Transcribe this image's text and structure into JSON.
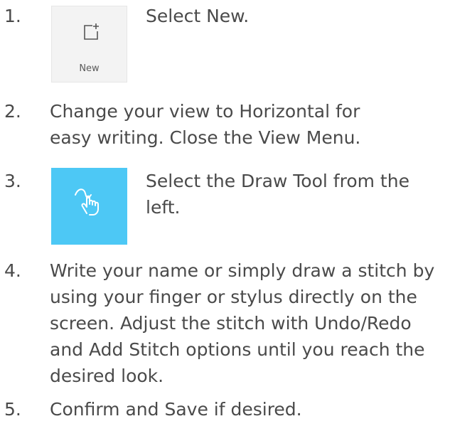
{
  "steps": [
    {
      "number": "1.",
      "text": "Select New.",
      "thumbnail": {
        "kind": "new-button",
        "icon": "new-document-icon",
        "label": "New"
      }
    },
    {
      "number": "2.",
      "text": "Change your view to Horizontal for easy writing. Close the View Menu."
    },
    {
      "number": "3.",
      "text": "Select the Draw Tool from the left.",
      "thumbnail": {
        "kind": "draw-tool",
        "icon": "draw-hand-icon",
        "color": "#4dc8f5"
      }
    },
    {
      "number": "4.",
      "text": "Write your name or simply draw a stitch by using your finger or stylus directly on the screen. Adjust the stitch with Undo/Redo and Add Stitch options until you reach the desired look."
    },
    {
      "number": "5.",
      "text": "Confirm and Save if desired."
    }
  ]
}
